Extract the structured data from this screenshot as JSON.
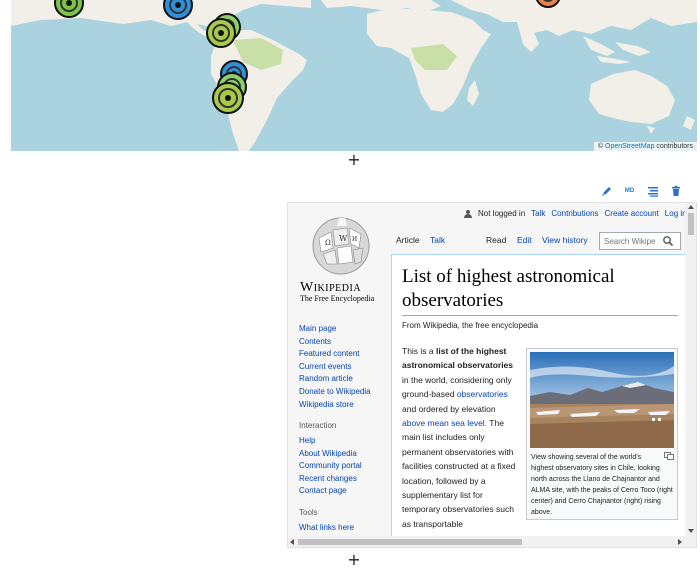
{
  "map": {
    "attribution_prefix": "©",
    "attribution_link": "OpenStreetMap",
    "attribution_suffix": "contributors",
    "colors": {
      "ocean": "#aad3df",
      "land": "#f2efe9",
      "forest": "#c8dfa8"
    },
    "markers": [
      {
        "color": "#7cc34a",
        "icon": "eye-icon"
      },
      {
        "color": "#2f8fd8",
        "icon": "eye-icon"
      },
      {
        "color": "#8bd06b",
        "icon": "eye-icon"
      },
      {
        "color": "#a8c94a",
        "icon": "eye-icon"
      },
      {
        "color": "#2f8fd8",
        "icon": "eye-icon"
      },
      {
        "color": "#8bd06b",
        "icon": "eye-icon"
      },
      {
        "color": "#a8c94a",
        "icon": "eye-icon"
      },
      {
        "color": "#e8844a",
        "icon": "eye-icon"
      }
    ]
  },
  "add_buttons": {
    "top": "+",
    "bottom": "+"
  },
  "toolbar": {
    "edit_icon": "pencil-icon",
    "md_label": "MD",
    "align_icon": "align-icon",
    "delete_icon": "trash-icon"
  },
  "wiki": {
    "wordmark": "Wikipedia",
    "tagline": "The Free Encyclopedia",
    "nav_main": [
      "Main page",
      "Contents",
      "Featured content",
      "Current events",
      "Random article",
      "Donate to Wikipedia",
      "Wikipedia store"
    ],
    "interaction_heading": "Interaction",
    "nav_interaction": [
      "Help",
      "About Wikipedia",
      "Community portal",
      "Recent changes",
      "Contact page"
    ],
    "tools_heading": "Tools",
    "nav_tools": [
      "What links here"
    ],
    "personal": {
      "status": "Not logged in",
      "talk": "Talk",
      "contributions": "Contributions",
      "create_account": "Create account",
      "log_in": "Log in"
    },
    "tabs": {
      "article": "Article",
      "talk": "Talk",
      "read": "Read",
      "edit": "Edit",
      "history": "View history"
    },
    "search_placeholder": "Search Wikipe",
    "title": "List of highest astronomical observatories",
    "from": "From Wikipedia, the free encyclopedia",
    "body": {
      "p1": "This is a ",
      "b1": "list of the highest astronomical observatories",
      "p2": " in the world, considering only ground-based ",
      "l1": "observatories",
      "p3": " and ordered by elevation ",
      "l2": "above mean sea level",
      "p4": ". The main list includes only permanent observatories with facilities constructed at a fixed location, followed by a supplementary list for temporary observatories such as transportable"
    },
    "caption": "View showing several of the world's highest observatory sites in Chile, looking north across the Llano de Chajnantor and ALMA site, with the peaks of Cerro Toco (right center) and Cerro Chajnantor (right) rising above."
  }
}
